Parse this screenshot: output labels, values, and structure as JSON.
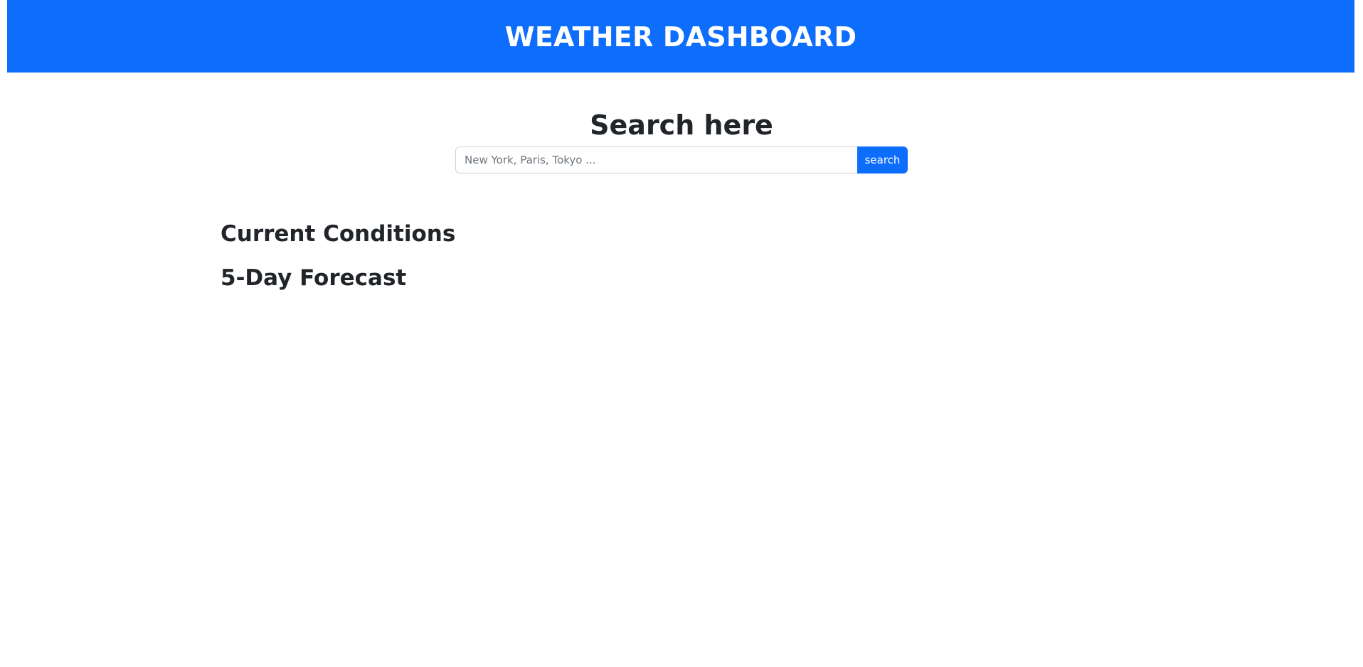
{
  "header": {
    "title": "WEATHER DASHBOARD"
  },
  "search": {
    "heading": "Search here",
    "placeholder": "New York, Paris, Tokyo ...",
    "value": "",
    "button_label": "search"
  },
  "sections": {
    "current_conditions": "Current Conditions",
    "forecast": "5-Day Forecast"
  },
  "colors": {
    "accent": "#0d6efd",
    "text": "#212529"
  }
}
